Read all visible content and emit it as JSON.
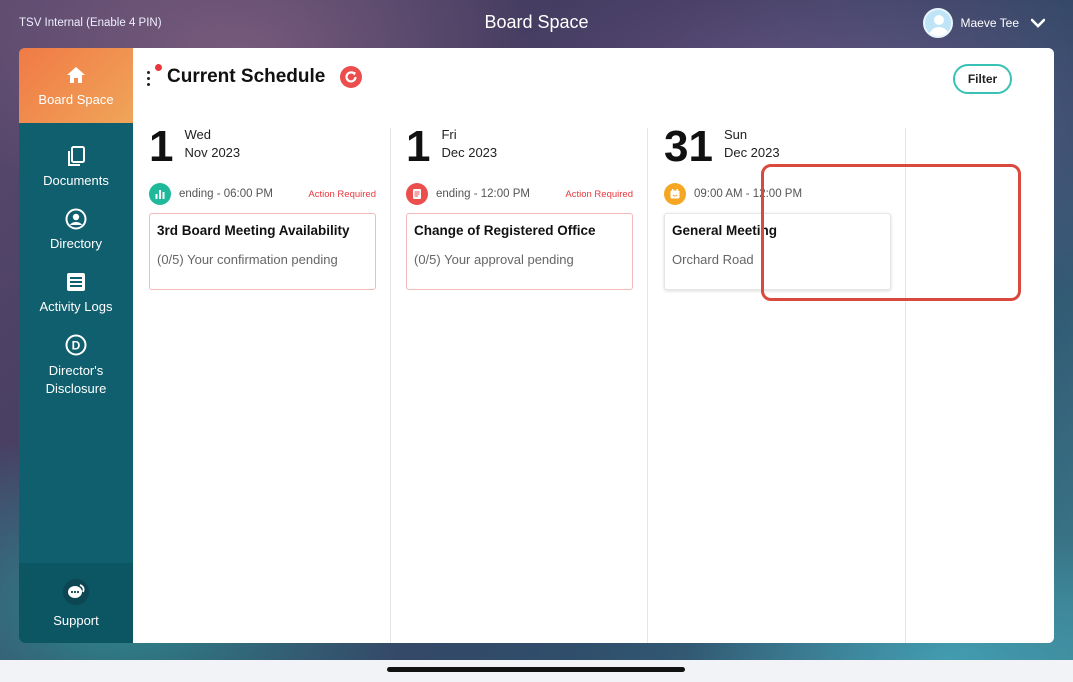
{
  "status_bar": {
    "app_label": "TSV Internal (Enable 4 PIN)",
    "title": "Board Space"
  },
  "user": {
    "name": "Maeve Tee",
    "avatar_icon": "user-avatar-icon",
    "menu_icon": "chevron-down-icon"
  },
  "sidebar": {
    "items": [
      {
        "label": "Board Space",
        "icon": "home-icon",
        "active": true
      },
      {
        "label": "Documents",
        "icon": "documents-icon"
      },
      {
        "label": "Directory",
        "icon": "person-icon"
      },
      {
        "label": "Activity Logs",
        "icon": "list-icon"
      },
      {
        "label": "Director's Disclosure",
        "icon": "disclosure-d-icon"
      }
    ],
    "support": {
      "label": "Support",
      "icon": "support-chat-icon"
    }
  },
  "header": {
    "title": "Current Schedule",
    "refresh_icon": "refresh-icon",
    "filter_label": "Filter"
  },
  "columns": [
    {
      "day_num": "1",
      "weekday": "Wed",
      "month_year": "Nov 2023",
      "time": "ending - 06:00 PM",
      "action": "Action Required",
      "badge_icon": "poll-icon",
      "badge_color": "#1fb89a",
      "card_title": "3rd Board Meeting Availability",
      "card_sub": "(0/5) Your confirmation pending"
    },
    {
      "day_num": "1",
      "weekday": "Fri",
      "month_year": "Dec 2023",
      "time": "ending - 12:00 PM",
      "action": "Action Required",
      "badge_icon": "document-icon",
      "badge_color": "#ec4d4d",
      "card_title": "Change of Registered Office",
      "card_sub": "(0/5) Your approval pending"
    },
    {
      "day_num": "31",
      "weekday": "Sun",
      "month_year": "Dec 2023",
      "time": "09:00 AM - 12:00 PM",
      "action": "",
      "badge_icon": "calendar-icon",
      "badge_color": "#f5a623",
      "card_title": "General Meeting",
      "card_sub": "Orchard Road"
    }
  ],
  "colors": {
    "accent": "#38c2b5",
    "sidebar": "#105f6e",
    "active_nav": "#f07a45",
    "alert": "#e8383d"
  }
}
